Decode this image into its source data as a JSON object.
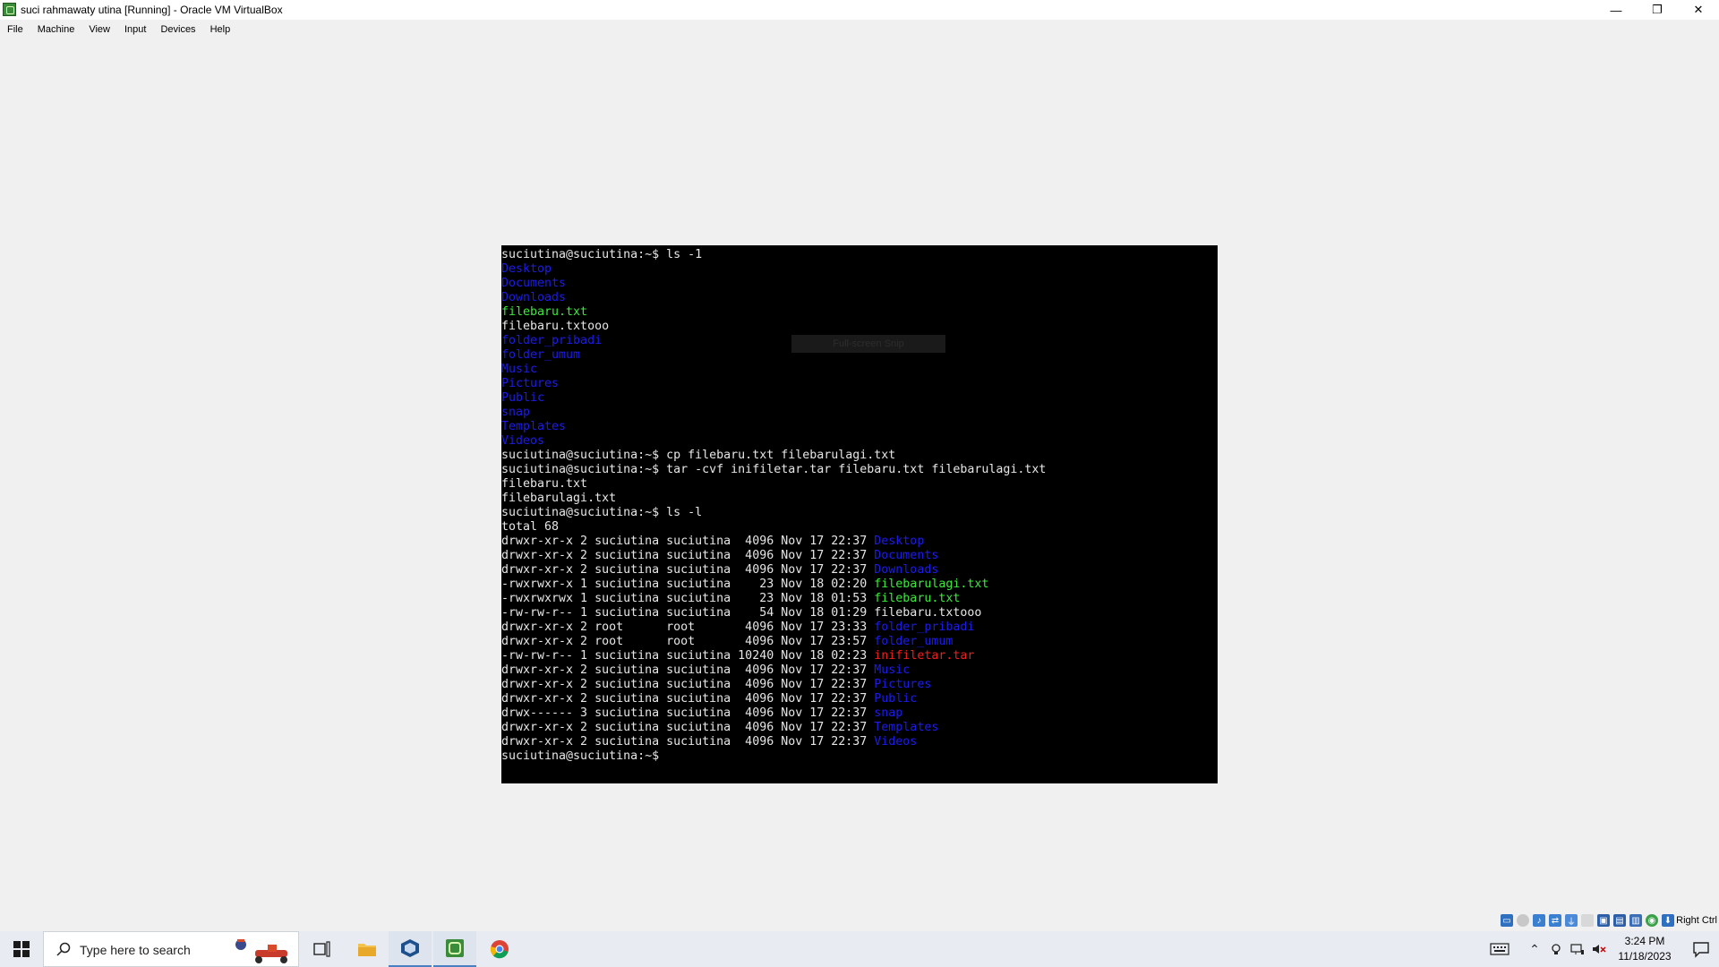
{
  "window": {
    "title": "suci rahmawaty utina [Running] - Oracle VM VirtualBox",
    "controls": [
      "—",
      "❐",
      "✕"
    ]
  },
  "menubar": {
    "items": [
      "File",
      "Machine",
      "View",
      "Input",
      "Devices",
      "Help"
    ]
  },
  "terminal": {
    "overlay_label": "Full-screen Snip",
    "lines": [
      {
        "segments": [
          {
            "text": "suciutina@suciutina:~$ ls -1",
            "kind": "plain"
          }
        ]
      },
      {
        "segments": [
          {
            "text": "Desktop",
            "kind": "dir"
          }
        ]
      },
      {
        "segments": [
          {
            "text": "Documents",
            "kind": "dir"
          }
        ]
      },
      {
        "segments": [
          {
            "text": "Downloads",
            "kind": "dir"
          }
        ]
      },
      {
        "segments": [
          {
            "text": "filebaru.txt",
            "kind": "exe"
          }
        ]
      },
      {
        "segments": [
          {
            "text": "filebaru.txtooo",
            "kind": "plain"
          }
        ]
      },
      {
        "segments": [
          {
            "text": "folder_pribadi",
            "kind": "dir"
          }
        ]
      },
      {
        "segments": [
          {
            "text": "folder_umum",
            "kind": "dir"
          }
        ]
      },
      {
        "segments": [
          {
            "text": "Music",
            "kind": "dir"
          }
        ]
      },
      {
        "segments": [
          {
            "text": "Pictures",
            "kind": "dir"
          }
        ]
      },
      {
        "segments": [
          {
            "text": "Public",
            "kind": "dir"
          }
        ]
      },
      {
        "segments": [
          {
            "text": "snap",
            "kind": "dir"
          }
        ]
      },
      {
        "segments": [
          {
            "text": "Templates",
            "kind": "dir"
          }
        ]
      },
      {
        "segments": [
          {
            "text": "Videos",
            "kind": "dir"
          }
        ]
      },
      {
        "segments": [
          {
            "text": "suciutina@suciutina:~$ cp filebaru.txt filebarulagi.txt",
            "kind": "plain"
          }
        ]
      },
      {
        "segments": [
          {
            "text": "suciutina@suciutina:~$ tar -cvf inifiletar.tar filebaru.txt filebarulagi.txt",
            "kind": "plain"
          }
        ]
      },
      {
        "segments": [
          {
            "text": "filebaru.txt",
            "kind": "plain"
          }
        ]
      },
      {
        "segments": [
          {
            "text": "filebarulagi.txt",
            "kind": "plain"
          }
        ]
      },
      {
        "segments": [
          {
            "text": "suciutina@suciutina:~$ ls -l",
            "kind": "plain"
          }
        ]
      },
      {
        "segments": [
          {
            "text": "total 68",
            "kind": "plain"
          }
        ]
      },
      {
        "segments": [
          {
            "text": "drwxr-xr-x 2 suciutina suciutina  4096 Nov 17 22:37 ",
            "kind": "plain"
          },
          {
            "text": "Desktop",
            "kind": "dir"
          }
        ]
      },
      {
        "segments": [
          {
            "text": "drwxr-xr-x 2 suciutina suciutina  4096 Nov 17 22:37 ",
            "kind": "plain"
          },
          {
            "text": "Documents",
            "kind": "dir"
          }
        ]
      },
      {
        "segments": [
          {
            "text": "drwxr-xr-x 2 suciutina suciutina  4096 Nov 17 22:37 ",
            "kind": "plain"
          },
          {
            "text": "Downloads",
            "kind": "dir"
          }
        ]
      },
      {
        "segments": [
          {
            "text": "-rwxrwxr-x 1 suciutina suciutina    23 Nov 18 02:20 ",
            "kind": "plain"
          },
          {
            "text": "filebarulagi.txt",
            "kind": "exe"
          }
        ]
      },
      {
        "segments": [
          {
            "text": "-rwxrwxrwx 1 suciutina suciutina    23 Nov 18 01:53 ",
            "kind": "plain"
          },
          {
            "text": "filebaru.txt",
            "kind": "exe"
          }
        ]
      },
      {
        "segments": [
          {
            "text": "-rw-rw-r-- 1 suciutina suciutina    54 Nov 18 01:29 ",
            "kind": "plain"
          },
          {
            "text": "filebaru.txtooo",
            "kind": "plain"
          }
        ]
      },
      {
        "segments": [
          {
            "text": "drwxr-xr-x 2 root      root       4096 Nov 17 23:33 ",
            "kind": "plain"
          },
          {
            "text": "folder_pribadi",
            "kind": "dir"
          }
        ]
      },
      {
        "segments": [
          {
            "text": "drwxr-xr-x 2 root      root       4096 Nov 17 23:57 ",
            "kind": "plain"
          },
          {
            "text": "folder_umum",
            "kind": "dir"
          }
        ]
      },
      {
        "segments": [
          {
            "text": "-rw-rw-r-- 1 suciutina suciutina 10240 Nov 18 02:23 ",
            "kind": "plain"
          },
          {
            "text": "inifiletar.tar",
            "kind": "tar"
          }
        ]
      },
      {
        "segments": [
          {
            "text": "drwxr-xr-x 2 suciutina suciutina  4096 Nov 17 22:37 ",
            "kind": "plain"
          },
          {
            "text": "Music",
            "kind": "dir"
          }
        ]
      },
      {
        "segments": [
          {
            "text": "drwxr-xr-x 2 suciutina suciutina  4096 Nov 17 22:37 ",
            "kind": "plain"
          },
          {
            "text": "Pictures",
            "kind": "dir"
          }
        ]
      },
      {
        "segments": [
          {
            "text": "drwxr-xr-x 2 suciutina suciutina  4096 Nov 17 22:37 ",
            "kind": "plain"
          },
          {
            "text": "Public",
            "kind": "dir"
          }
        ]
      },
      {
        "segments": [
          {
            "text": "drwx------ 3 suciutina suciutina  4096 Nov 17 22:37 ",
            "kind": "plain"
          },
          {
            "text": "snap",
            "kind": "dir"
          }
        ]
      },
      {
        "segments": [
          {
            "text": "drwxr-xr-x 2 suciutina suciutina  4096 Nov 17 22:37 ",
            "kind": "plain"
          },
          {
            "text": "Templates",
            "kind": "dir"
          }
        ]
      },
      {
        "segments": [
          {
            "text": "drwxr-xr-x 2 suciutina suciutina  4096 Nov 17 22:37 ",
            "kind": "plain"
          },
          {
            "text": "Videos",
            "kind": "dir"
          }
        ]
      },
      {
        "segments": [
          {
            "text": "suciutina@suciutina:~$ ",
            "kind": "plain"
          }
        ]
      }
    ],
    "colors": {
      "dir": "#1c1ce8",
      "exe": "#3ce83c",
      "tar": "#e82020",
      "plain": "#e6e6e6"
    }
  },
  "statusbar": {
    "host_key": "Right Ctrl",
    "icons": [
      "hard-disk-icon",
      "optical-drive-icon",
      "audio-icon",
      "network-icon",
      "usb-icon",
      "shared-folders-icon",
      "display-icon",
      "recording-icon",
      "cpu-icon",
      "mouse-integration-icon",
      "keyboard-capture-icon"
    ]
  },
  "taskbar": {
    "search_placeholder": "Type here to search",
    "pinned": [
      "task-view-icon",
      "file-explorer-icon",
      "virtualbox-icon",
      "vm-running-icon",
      "chrome-icon"
    ],
    "clock_time": "3:24 PM",
    "clock_date": "11/18/2023",
    "tray_icons": [
      "keyboard-layout-icon",
      "show-hidden-icons",
      "meet-now-icon",
      "network-status-icon",
      "volume-muted-icon"
    ]
  }
}
